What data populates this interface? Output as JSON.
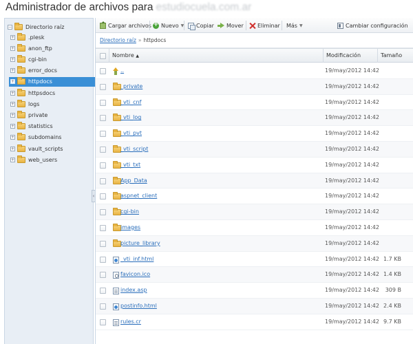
{
  "header": {
    "title": "Administrador de archivos para",
    "domain_obscured": "estudiocuela.com.ar"
  },
  "sidebar": {
    "root_label": "Directorio raíz",
    "items": [
      {
        "label": ".plesk",
        "selected": false
      },
      {
        "label": "anon_ftp",
        "selected": false
      },
      {
        "label": "cgi-bin",
        "selected": false
      },
      {
        "label": "error_docs",
        "selected": false
      },
      {
        "label": "httpdocs",
        "selected": true
      },
      {
        "label": "httpsdocs",
        "selected": false
      },
      {
        "label": "logs",
        "selected": false
      },
      {
        "label": "private",
        "selected": false
      },
      {
        "label": "statistics",
        "selected": false
      },
      {
        "label": "subdomains",
        "selected": false
      },
      {
        "label": "vault_scripts",
        "selected": false
      },
      {
        "label": "web_users",
        "selected": false
      }
    ]
  },
  "toolbar": {
    "upload_label": "Cargar archivos",
    "new_label": "Nuevo",
    "copy_label": "Copiar",
    "move_label": "Mover",
    "delete_label": "Eliminar",
    "more_label": "Más",
    "settings_label": "Cambiar configuración"
  },
  "breadcrumb": {
    "root": "Directorio raíz",
    "separator": "»",
    "current": "httpdocs"
  },
  "table": {
    "columns": {
      "name": "Nombre",
      "sort_indicator": "▲",
      "modified": "Modificación",
      "size": "Tamaño"
    },
    "rows": [
      {
        "name": "..",
        "type": "parent",
        "modified": "19/may/2012 14:42",
        "size": ""
      },
      {
        "name": "_private",
        "type": "folder",
        "modified": "19/may/2012 14:42",
        "size": ""
      },
      {
        "name": "_vti_cnf",
        "type": "folder",
        "modified": "19/may/2012 14:42",
        "size": ""
      },
      {
        "name": "_vti_log",
        "type": "folder",
        "modified": "19/may/2012 14:42",
        "size": ""
      },
      {
        "name": "_vti_pvt",
        "type": "folder",
        "modified": "19/may/2012 14:42",
        "size": ""
      },
      {
        "name": "_vti_script",
        "type": "folder",
        "modified": "19/may/2012 14:42",
        "size": ""
      },
      {
        "name": "_vti_txt",
        "type": "folder",
        "modified": "19/may/2012 14:42",
        "size": ""
      },
      {
        "name": "App_Data",
        "type": "folder",
        "modified": "19/may/2012 14:42",
        "size": ""
      },
      {
        "name": "aspnet_client",
        "type": "folder",
        "modified": "19/may/2012 14:42",
        "size": ""
      },
      {
        "name": "cgi-bin",
        "type": "folder",
        "modified": "19/may/2012 14:42",
        "size": ""
      },
      {
        "name": "images",
        "type": "folder",
        "modified": "19/may/2012 14:42",
        "size": ""
      },
      {
        "name": "picture_library",
        "type": "folder",
        "modified": "19/may/2012 14:42",
        "size": ""
      },
      {
        "name": "_vti_inf.html",
        "type": "web",
        "modified": "19/may/2012 14:42",
        "size": "1.7 KB"
      },
      {
        "name": "favicon.ico",
        "type": "ico",
        "modified": "19/may/2012 14:42",
        "size": "1.4 KB"
      },
      {
        "name": "index.asp",
        "type": "text",
        "modified": "19/may/2012 14:42",
        "size": "309 B"
      },
      {
        "name": "postinfo.html",
        "type": "web",
        "modified": "19/may/2012 14:42",
        "size": "2.4 KB"
      },
      {
        "name": "rules.cr",
        "type": "text",
        "modified": "19/may/2012 14:42",
        "size": "9.7 KB"
      }
    ]
  },
  "colors": {
    "selected_bg": "#3a8fd6",
    "link": "#2a6ebb",
    "sidebar_bg": "#e8eef5"
  }
}
